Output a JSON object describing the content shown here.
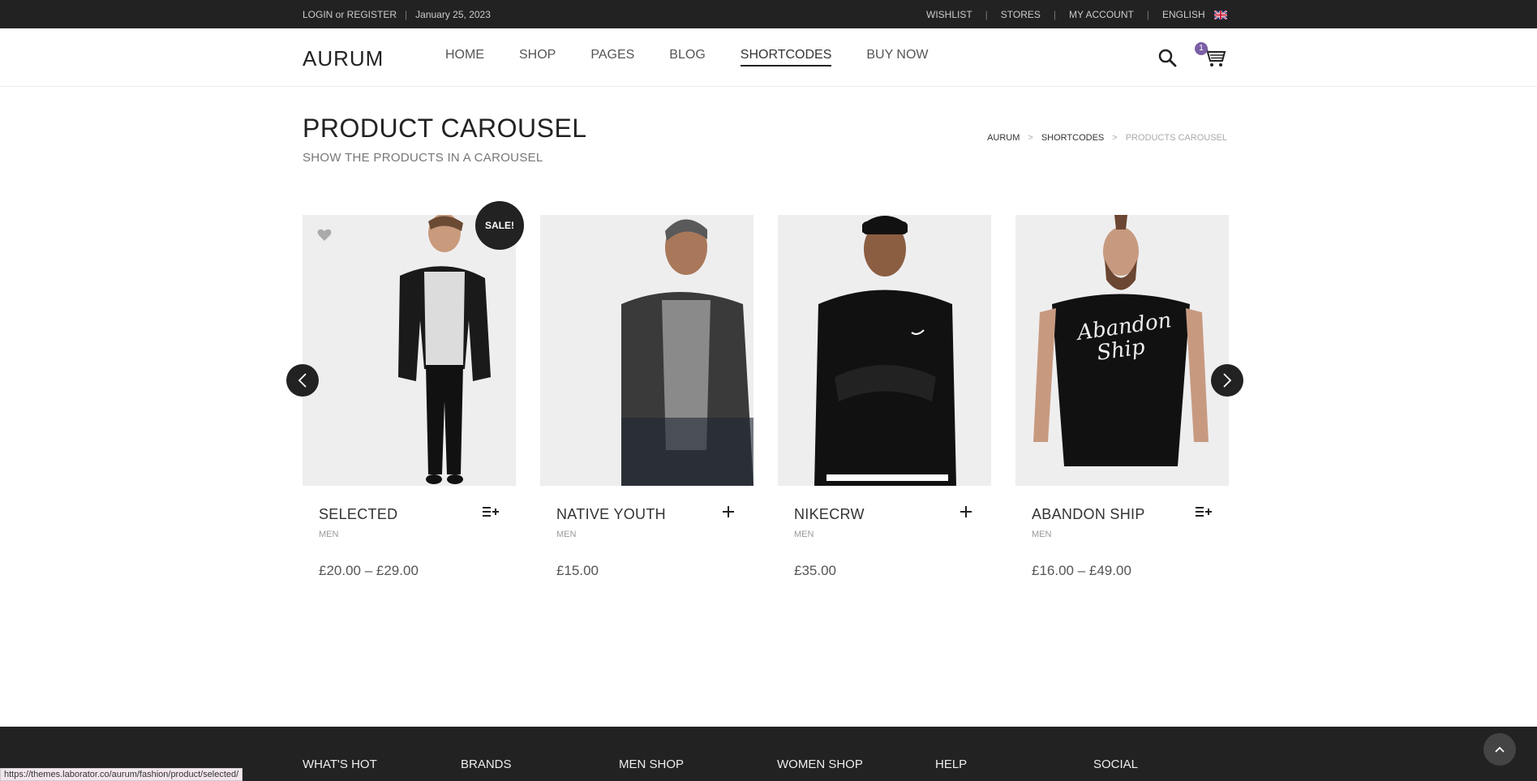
{
  "topbar": {
    "login_text": "LOGIN or REGISTER",
    "separator": "|",
    "date": "January 25, 2023",
    "links": [
      "WISHLIST",
      "STORES",
      "MY ACCOUNT",
      "ENGLISH"
    ],
    "link_separator": "|"
  },
  "header": {
    "logo": "AURUM",
    "nav": [
      "HOME",
      "SHOP",
      "PAGES",
      "BLOG",
      "SHORTCODES",
      "BUY NOW"
    ],
    "active_nav": "SHORTCODES",
    "cart_count": "1",
    "accent": "#7b5fa6"
  },
  "page": {
    "title": "PRODUCT CAROUSEL",
    "subtitle": "SHOW THE PRODUCTS IN A CAROUSEL"
  },
  "breadcrumb": {
    "items": [
      "AURUM",
      "SHORTCODES",
      "PRODUCTS CAROUSEL"
    ],
    "arrow": ">"
  },
  "products": [
    {
      "name": "SELECTED",
      "category": "MEN",
      "price": "£20.00 – £29.00",
      "icon": "select-options-icon"
    },
    {
      "name": "NATIVE YOUTH",
      "category": "MEN",
      "price": "£15.00",
      "icon": "add-to-cart-icon"
    },
    {
      "name": "NIKECRW",
      "category": "MEN",
      "price": "£35.00",
      "icon": "add-to-cart-icon"
    },
    {
      "name": "ABANDON SHIP",
      "category": "MEN",
      "price": "£16.00 – £49.00",
      "icon": "select-options-icon"
    }
  ],
  "sale_badge": "SALE!",
  "footer": {
    "columns": [
      "WHAT'S HOT",
      "BRANDS",
      "MEN SHOP",
      "WOMEN SHOP",
      "HELP",
      "SOCIAL"
    ]
  },
  "status_bar": {
    "url": "https://themes.laborator.co/aurum/fashion/product/selected/"
  }
}
